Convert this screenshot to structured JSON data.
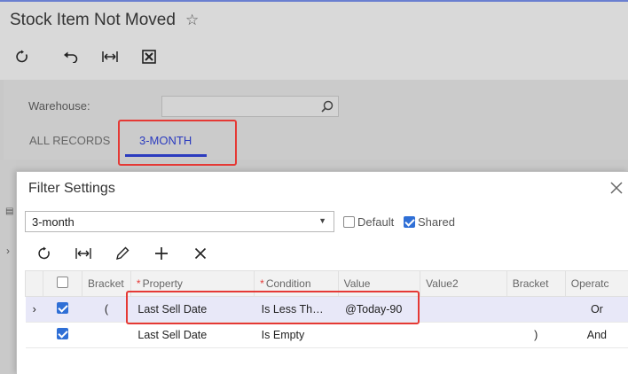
{
  "page": {
    "title": "Stock Item Not Moved",
    "toolbar": [
      {
        "icon": "refresh-icon"
      },
      {
        "icon": "undo-icon"
      },
      {
        "icon": "fit-width-icon"
      },
      {
        "icon": "excel-export-icon"
      }
    ],
    "warehouse_label": "Warehouse:",
    "warehouse_value": "",
    "tabs": [
      "ALL RECORDS",
      "3-MONTH"
    ],
    "active_tab": "3-MONTH"
  },
  "dialog": {
    "title": "Filter Settings",
    "preset": "3-month",
    "default_label": "Default",
    "default_checked": false,
    "shared_label": "Shared",
    "shared_checked": true,
    "toolbar": [
      {
        "icon": "refresh-icon"
      },
      {
        "icon": "fit-width-icon"
      },
      {
        "icon": "pencil-icon"
      },
      {
        "icon": "plus-icon"
      },
      {
        "icon": "close-icon"
      }
    ],
    "columns": [
      "Bracket",
      "Property",
      "Condition",
      "Value",
      "Value2",
      "Bracket",
      "Operator"
    ],
    "column_display": [
      "Bracket",
      "Property",
      "Condition",
      "Value",
      "Value2",
      "Bracket",
      "Operatc"
    ],
    "rows": [
      {
        "active": true,
        "selected": true,
        "bracket_open": "(",
        "property": "Last Sell Date",
        "condition": "Is Less Th…",
        "value": "@Today-90",
        "value2": "",
        "bracket_close": "",
        "operator": "Or"
      },
      {
        "active": true,
        "selected": false,
        "bracket_open": "",
        "property": "Last Sell Date",
        "condition": "Is Empty",
        "value": "",
        "value2": "",
        "bracket_close": ")",
        "operator": "And"
      }
    ]
  },
  "colors": {
    "accent": "#2b3bbf",
    "highlight": "#e53935",
    "checkbox": "#2f6fd6",
    "selected_row": "#e8e8f8"
  }
}
